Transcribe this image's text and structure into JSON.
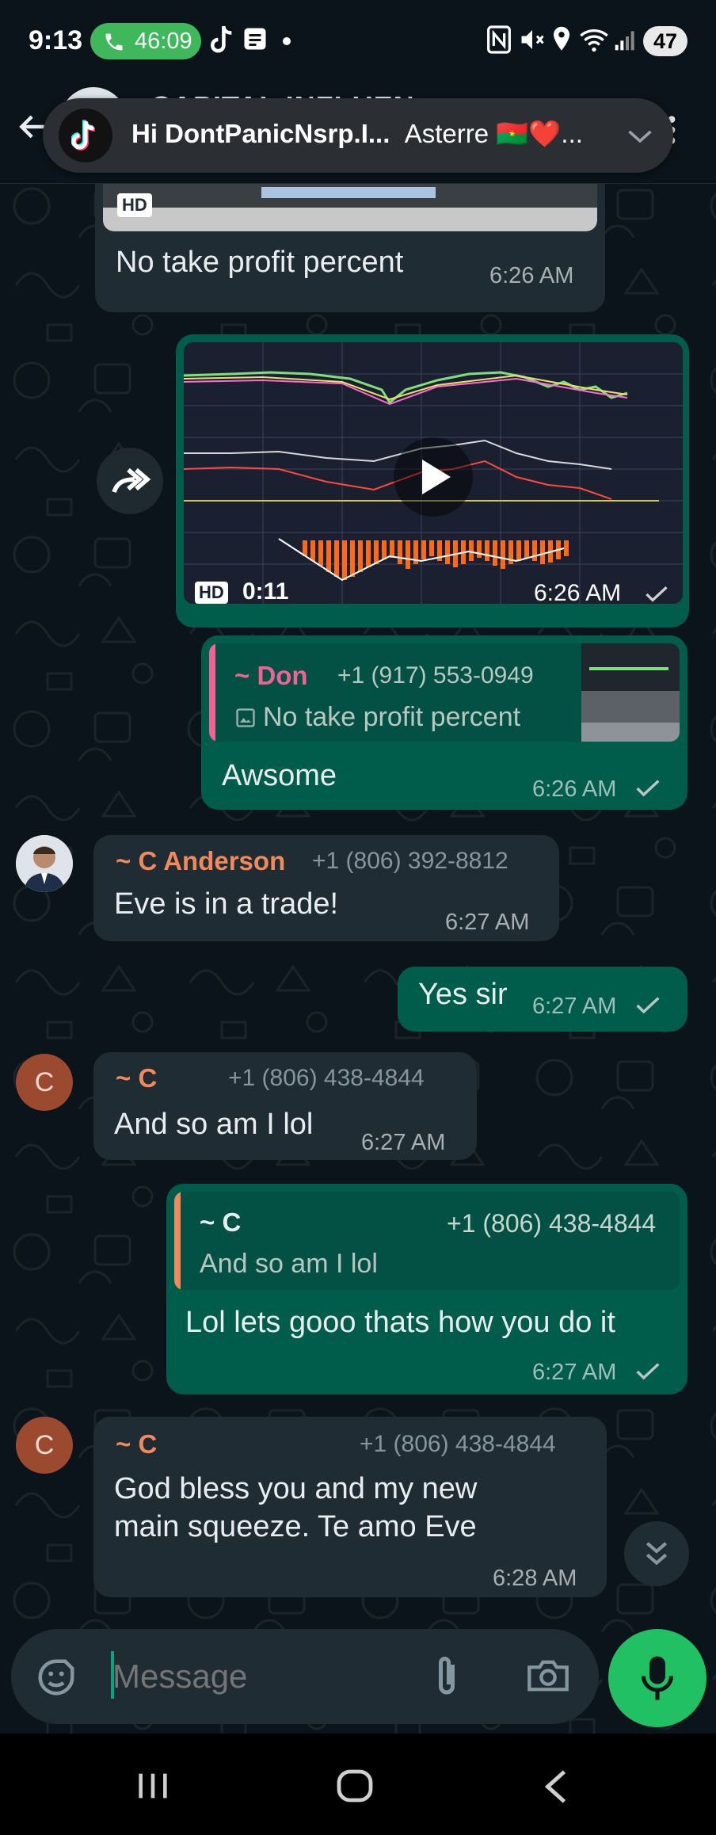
{
  "status_bar": {
    "time": "9:13",
    "call_timer": "46:09",
    "battery": "47"
  },
  "header": {
    "title": "CAPITAL INFLUEN"
  },
  "notification": {
    "text_bold": "Hi DontPanicNsrp.I...",
    "text_rest": "Asterre 🇧🇫❤️..."
  },
  "messages": [
    {
      "type": "incoming-media-caption",
      "text": "No take profit percent",
      "time": "6:26 AM",
      "badge": "HD"
    },
    {
      "type": "outgoing-video",
      "duration": "0:11",
      "time": "6:26 AM",
      "badge": "HD"
    },
    {
      "type": "outgoing-reply",
      "quote_name": "~ Don",
      "quote_phone": "+1 (917) 553-0949",
      "quote_text": "No take profit percent",
      "text": "Awsome",
      "time": "6:26 AM"
    },
    {
      "type": "incoming",
      "name": "~ C Anderson",
      "phone": "+1 (806) 392-8812",
      "text": "Eve is in a trade!",
      "time": "6:27 AM"
    },
    {
      "type": "outgoing",
      "text": "Yes sir",
      "time": "6:27 AM"
    },
    {
      "type": "incoming",
      "avatar": "C",
      "name": "~ C",
      "phone": "+1 (806) 438-4844",
      "text": "And so am I lol",
      "time": "6:27 AM"
    },
    {
      "type": "outgoing-reply",
      "quote_name": "~ C",
      "quote_phone": "+1 (806) 438-4844",
      "quote_text": "And so am I lol",
      "text": "Lol lets gooo thats how you do it",
      "time": "6:27 AM"
    },
    {
      "type": "incoming",
      "avatar": "C",
      "name": "~ C",
      "phone": "+1 (806) 438-4844",
      "text_line1": "God bless you and my new",
      "text_line2": "main squeeze. Te amo Eve",
      "time": "6:28 AM"
    }
  ],
  "composer": {
    "placeholder": "Message"
  },
  "colors": {
    "background": "#0b141a",
    "incoming_bubble": "#202c33",
    "outgoing_bubble": "#005c4b",
    "accent": "#21c063",
    "name_orange": "#f08a5d",
    "don_pink": "#f06292",
    "timestamp": "#8696a0"
  },
  "icons": [
    "phone-icon",
    "tiktok-icon",
    "note-icon",
    "nfc-icon",
    "mute-icon",
    "location-icon",
    "wifi-icon",
    "signal-icon",
    "battery-icon",
    "back-arrow-icon",
    "more-vert-icon",
    "chevron-down-icon",
    "forward-icon",
    "play-icon",
    "check-icon",
    "double-chevron-down-icon",
    "sticker-icon",
    "attach-icon",
    "camera-icon",
    "mic-icon",
    "recents-icon",
    "home-icon",
    "nav-back-icon"
  ]
}
